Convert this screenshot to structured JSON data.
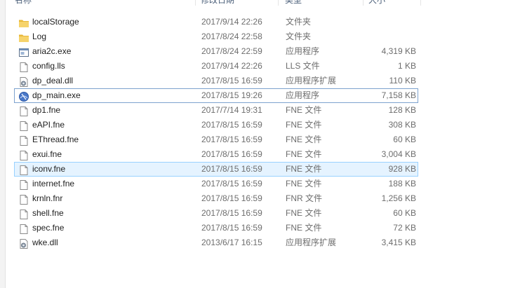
{
  "columns": {
    "name": "名称",
    "date": "修改日期",
    "type": "类型",
    "size": "大小"
  },
  "files": [
    {
      "name": "localStorage",
      "date": "2017/9/14 22:26",
      "type": "文件夹",
      "size": "",
      "icon": "folder-icon"
    },
    {
      "name": "Log",
      "date": "2017/8/24 22:58",
      "type": "文件夹",
      "size": "",
      "icon": "folder-icon"
    },
    {
      "name": "aria2c.exe",
      "date": "2017/8/24 22:59",
      "type": "应用程序",
      "size": "4,319 KB",
      "icon": "exe-window-icon"
    },
    {
      "name": "config.lls",
      "date": "2017/9/14 22:26",
      "type": "LLS 文件",
      "size": "1 KB",
      "icon": "file-icon"
    },
    {
      "name": "dp_deal.dll",
      "date": "2017/8/15 16:59",
      "type": "应用程序扩展",
      "size": "110 KB",
      "icon": "dll-gear-icon"
    },
    {
      "name": "dp_main.exe",
      "date": "2017/8/15 19:26",
      "type": "应用程序",
      "size": "7,158 KB",
      "icon": "app-globe-icon"
    },
    {
      "name": "dp1.fne",
      "date": "2017/7/14 19:31",
      "type": "FNE 文件",
      "size": "128 KB",
      "icon": "file-icon"
    },
    {
      "name": "eAPI.fne",
      "date": "2017/8/15 16:59",
      "type": "FNE 文件",
      "size": "308 KB",
      "icon": "file-icon"
    },
    {
      "name": "EThread.fne",
      "date": "2017/8/15 16:59",
      "type": "FNE 文件",
      "size": "60 KB",
      "icon": "file-icon"
    },
    {
      "name": "exui.fne",
      "date": "2017/8/15 16:59",
      "type": "FNE 文件",
      "size": "3,004 KB",
      "icon": "file-icon"
    },
    {
      "name": "iconv.fne",
      "date": "2017/8/15 16:59",
      "type": "FNE 文件",
      "size": "928 KB",
      "icon": "file-icon"
    },
    {
      "name": "internet.fne",
      "date": "2017/8/15 16:59",
      "type": "FNE 文件",
      "size": "188 KB",
      "icon": "file-icon"
    },
    {
      "name": "krnln.fnr",
      "date": "2017/8/15 16:59",
      "type": "FNR 文件",
      "size": "1,256 KB",
      "icon": "file-icon"
    },
    {
      "name": "shell.fne",
      "date": "2017/8/15 16:59",
      "type": "FNE 文件",
      "size": "60 KB",
      "icon": "file-icon"
    },
    {
      "name": "spec.fne",
      "date": "2017/8/15 16:59",
      "type": "FNE 文件",
      "size": "72 KB",
      "icon": "file-icon"
    },
    {
      "name": "wke.dll",
      "date": "2013/6/17 16:15",
      "type": "应用程序扩展",
      "size": "3,415 KB",
      "icon": "dll-gear-icon"
    }
  ],
  "selected_row": "dp_main.exe",
  "hover_row": "iconv.fne",
  "colors": {
    "selection_border": "#7da2ce",
    "hover_fill": "#e5f3ff",
    "hover_border": "#99d1ff",
    "folder": "#f4c84a"
  }
}
